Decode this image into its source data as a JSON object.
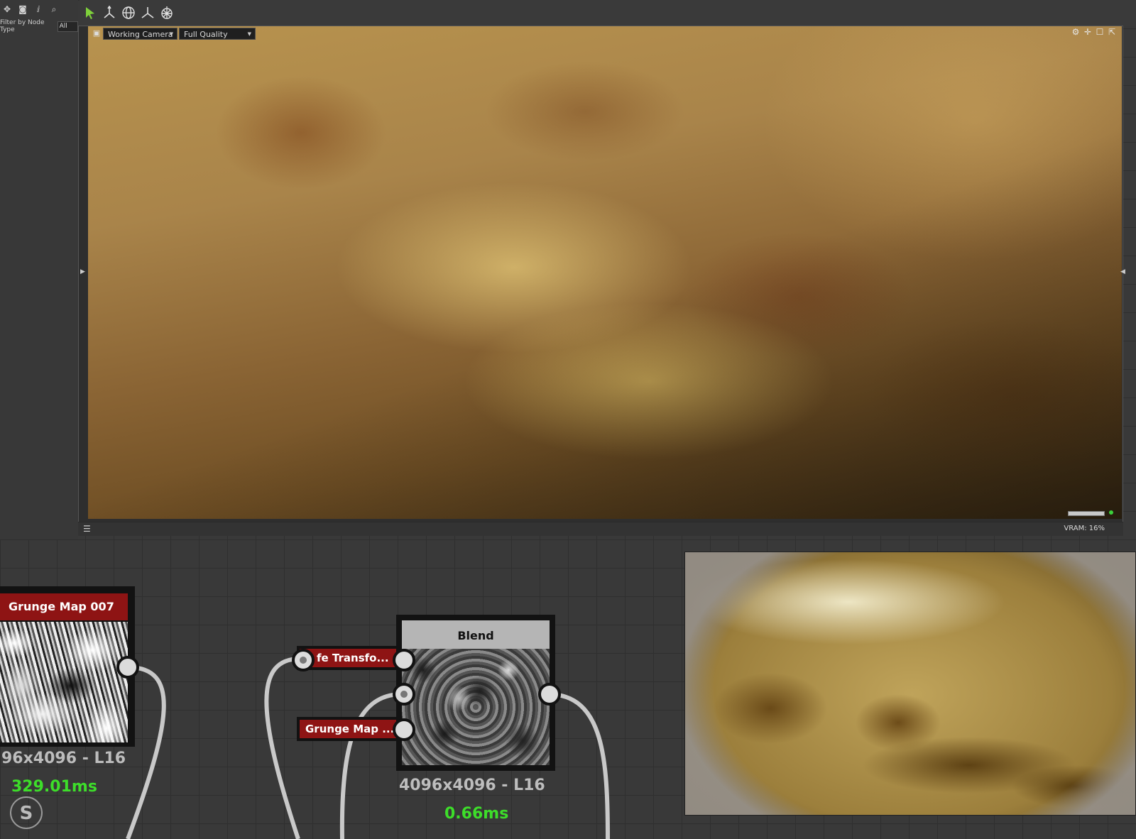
{
  "left_panel": {
    "filter_label": "Filter by Node Type",
    "filter_value": "All"
  },
  "toolbar": {
    "tools": [
      "select-arrow-icon",
      "axis-gizmo-icon",
      "globe-icon",
      "axis-tripod-icon",
      "light-sphere-icon"
    ],
    "active_color": "#7fd13b"
  },
  "viewport": {
    "camera_label": "Working Camera",
    "quality_label": "Full Quality",
    "vram": "VRAM: 16%",
    "right_icons": [
      "gear-icon",
      "move-icon",
      "square-icon",
      "popout-icon"
    ],
    "status_dot_color": "#3bd13b"
  },
  "nodes": {
    "grunge_map_007": {
      "title": "Grunge Map 007",
      "resolution": "96x4096 - L16",
      "time": "329.01ms"
    },
    "transform_input": {
      "title": "fe Transfo..."
    },
    "grunge_map_input": {
      "title": "Grunge Map ..."
    },
    "blend": {
      "title": "Blend",
      "resolution": "4096x4096 - L16",
      "time": "0.66ms"
    }
  },
  "colors": {
    "node_red": "#8e1414",
    "time_green": "#3dde2a",
    "node_grey_header": "#b5b5b5"
  }
}
